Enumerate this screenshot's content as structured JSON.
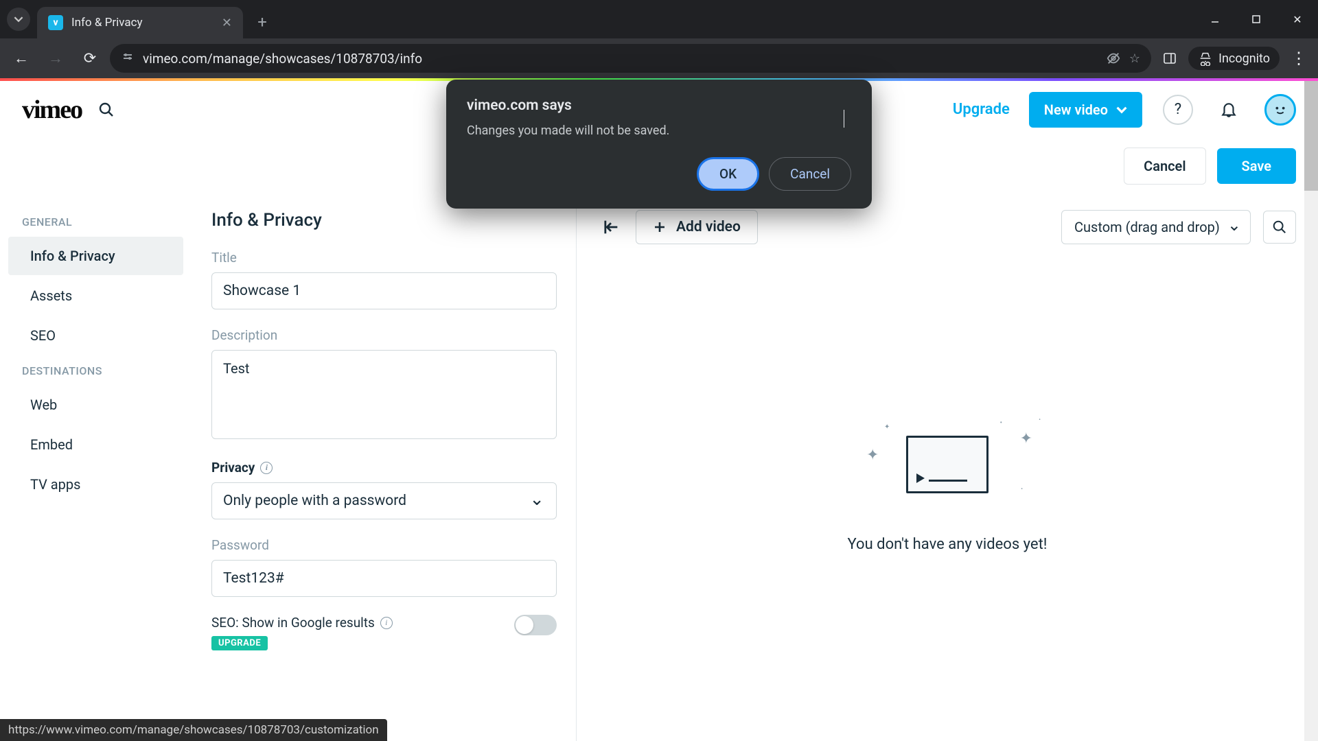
{
  "browser": {
    "tab_title": "Info & Privacy",
    "url": "vimeo.com/manage/showcases/10878703/info",
    "incognito_label": "Incognito",
    "status_bar_url": "https://www.vimeo.com/manage/showcases/10878703/customization"
  },
  "header": {
    "logo_text": "vimeo",
    "upgrade_label": "Upgrade",
    "new_video_label": "New video"
  },
  "actions": {
    "cancel_label": "Cancel",
    "save_label": "Save"
  },
  "sidebar": {
    "sections": {
      "general_label": "GENERAL",
      "destinations_label": "DESTINATIONS"
    },
    "items": {
      "info_privacy": "Info & Privacy",
      "assets": "Assets",
      "seo": "SEO",
      "web": "Web",
      "embed": "Embed",
      "tv_apps": "TV apps"
    }
  },
  "form": {
    "heading": "Info & Privacy",
    "title_label": "Title",
    "title_value": "Showcase 1",
    "description_label": "Description",
    "description_value": "Test",
    "privacy_label": "Privacy",
    "privacy_value": "Only people with a password",
    "password_label": "Password",
    "password_value": "Test123#",
    "seo_label": "SEO: Show in Google results",
    "upgrade_badge": "UPGRADE"
  },
  "video_panel": {
    "add_video_label": "Add video",
    "sort_value": "Custom (drag and drop)",
    "empty_text": "You don't have any videos yet!"
  },
  "dialog": {
    "title": "vimeo.com says",
    "message": "Changes you made will not be saved.",
    "ok_label": "OK",
    "cancel_label": "Cancel"
  }
}
